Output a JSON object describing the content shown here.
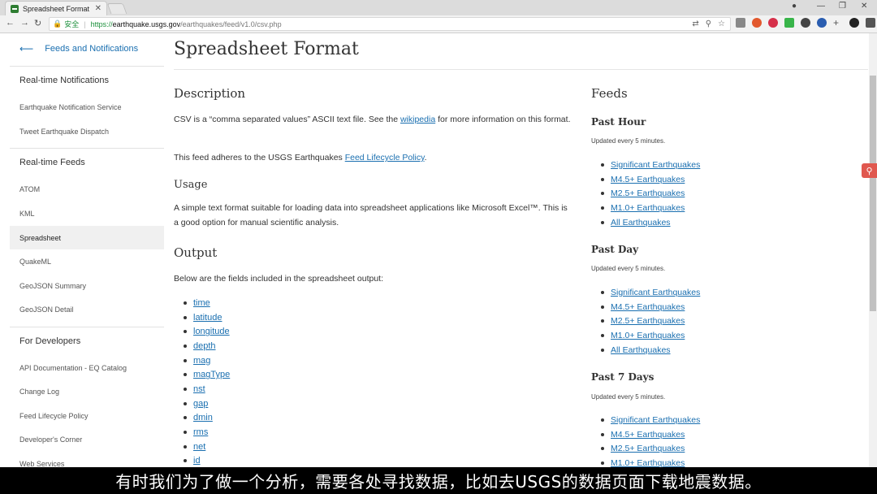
{
  "browser": {
    "tab_title": "Spreadsheet Format",
    "tab_close": "✕",
    "secure_label": "安全",
    "url_scheme": "https://",
    "url_host": "earthquake.usgs.gov",
    "url_path": "/earthquakes/feed/v1.0/csv.php"
  },
  "sidebar": {
    "back_label": "Feeds and Notifications",
    "section1_title": "Real-time Notifications",
    "section1_items": [
      "Earthquake Notification Service",
      "Tweet Earthquake Dispatch"
    ],
    "section2_title": "Real-time Feeds",
    "section2_items": [
      "ATOM",
      "KML",
      "Spreadsheet",
      "QuakeML",
      "GeoJSON Summary",
      "GeoJSON Detail"
    ],
    "section3_title": "For Developers",
    "section3_items": [
      "API Documentation - EQ Catalog",
      "Change Log",
      "Feed Lifecycle Policy",
      "Developer's Corner",
      "Web Services"
    ]
  },
  "main": {
    "title": "Spreadsheet Format",
    "description_heading": "Description",
    "desc_text_1": "CSV is a “comma separated values” ASCII text file. See the ",
    "desc_link": "wikipedia",
    "desc_text_2": " for more information on this format.",
    "policy_text_1": "This feed adheres to the USGS Earthquakes ",
    "policy_link": "Feed Lifecycle Policy",
    "policy_text_2": ".",
    "usage_heading": "Usage",
    "usage_text": "A simple text format suitable for loading data into spreadsheet applications like Microsoft Excel™. This is a good option for manual scientific analysis.",
    "output_heading": "Output",
    "output_text": "Below are the fields included in the spreadsheet output:",
    "fields": [
      "time",
      "latitude",
      "longitude",
      "depth",
      "mag",
      "magType",
      "nst",
      "gap",
      "dmin",
      "rms",
      "net",
      "id"
    ]
  },
  "feeds": {
    "heading": "Feeds",
    "groups": [
      {
        "title": "Past Hour",
        "updated": "Updated every 5 minutes.",
        "links": [
          "Significant Earthquakes",
          "M4.5+ Earthquakes",
          "M2.5+ Earthquakes",
          "M1.0+ Earthquakes",
          "All Earthquakes"
        ]
      },
      {
        "title": "Past Day",
        "updated": "Updated every 5 minutes.",
        "links": [
          "Significant Earthquakes",
          "M4.5+ Earthquakes",
          "M2.5+ Earthquakes",
          "M1.0+ Earthquakes",
          "All Earthquakes"
        ]
      },
      {
        "title": "Past 7 Days",
        "updated": "Updated every 5 minutes.",
        "links": [
          "Significant Earthquakes",
          "M4.5+ Earthquakes",
          "M2.5+ Earthquakes",
          "M1.0+ Earthquakes"
        ]
      }
    ]
  },
  "subtitle": "有时我们为了做一个分析，需要各处寻找数据，比如去USGS的数据页面下载地震数据。",
  "colors": {
    "link": "#1a6fb0",
    "secure": "#1a8f3a",
    "active_bg": "#f0f0f0"
  }
}
